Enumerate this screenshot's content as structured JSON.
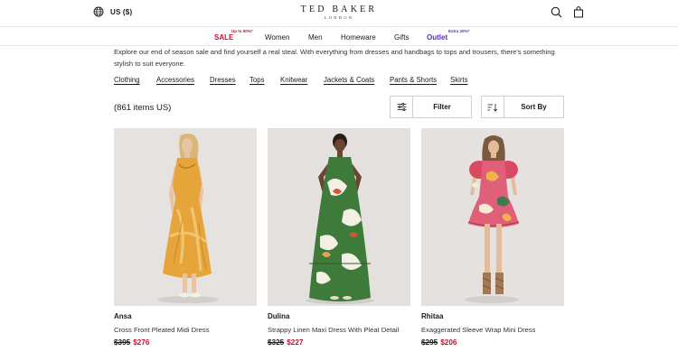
{
  "header": {
    "region_label": "US ($)",
    "logo_main": "TED BAKER",
    "logo_sub": "LONDON"
  },
  "nav": {
    "sale": {
      "label": "SALE",
      "sup": "Up to 50%*"
    },
    "women": "Women",
    "men": "Men",
    "homeware": "Homeware",
    "gifts": "Gifts",
    "outlet": {
      "label": "Outlet",
      "sup": "Extra 20%*"
    }
  },
  "intro": "Explore our end of season sale and find yourself a real steal. With everything from dresses and handbags to tops and trousers, there's something stylish to suit everyone.",
  "categories": [
    "Clothing",
    "Accessories",
    "Dresses",
    "Tops",
    "Knitwear",
    "Jackets & Coats",
    "Pants & Shorts",
    "Skirts"
  ],
  "toolbar": {
    "count": "(861 items US)",
    "filter_label": "Filter",
    "sort_label": "Sort By"
  },
  "products": [
    {
      "name": "Ansa",
      "desc": "Cross Front Pleated Midi Dress",
      "old_price": "$395",
      "new_price": "$276"
    },
    {
      "name": "Dulina",
      "desc": "Strappy Linen Maxi Dress With Pleat Detail",
      "old_price": "$325",
      "new_price": "$227"
    },
    {
      "name": "Rhitaa",
      "desc": "Exaggerated Sleeve Wrap Mini Dress",
      "old_price": "$295",
      "new_price": "$206"
    }
  ],
  "colors": {
    "sale": "#c8102e",
    "outlet": "#5a2ac8",
    "photo_bg": "#e5e2e0"
  }
}
